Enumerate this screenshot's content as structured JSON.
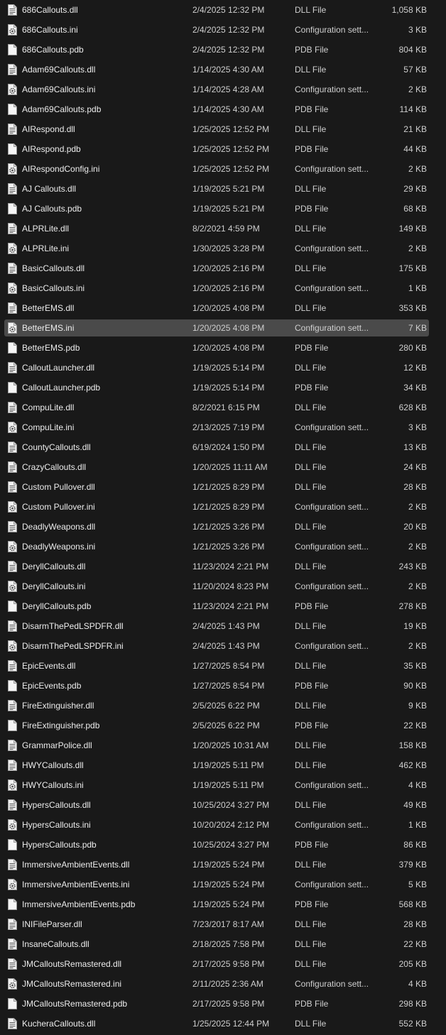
{
  "colors": {
    "background": "#191919",
    "selected_row": "#4a4a4a",
    "text": "#e6e6e6"
  },
  "files": [
    {
      "name": "686Callouts.dll",
      "date": "2/4/2025 12:32 PM",
      "type": "DLL File",
      "size": "1,058 KB",
      "icon": "dll-file-icon"
    },
    {
      "name": "686Callouts.ini",
      "date": "2/4/2025 12:32 PM",
      "type": "Configuration sett...",
      "size": "3 KB",
      "icon": "config-file-icon"
    },
    {
      "name": "686Callouts.pdb",
      "date": "2/4/2025 12:32 PM",
      "type": "PDB File",
      "size": "804 KB",
      "icon": "blank-file-icon"
    },
    {
      "name": "Adam69Callouts.dll",
      "date": "1/14/2025 4:30 AM",
      "type": "DLL File",
      "size": "57 KB",
      "icon": "dll-file-icon"
    },
    {
      "name": "Adam69Callouts.ini",
      "date": "1/14/2025 4:28 AM",
      "type": "Configuration sett...",
      "size": "2 KB",
      "icon": "config-file-icon"
    },
    {
      "name": "Adam69Callouts.pdb",
      "date": "1/14/2025 4:30 AM",
      "type": "PDB File",
      "size": "114 KB",
      "icon": "blank-file-icon"
    },
    {
      "name": "AIRespond.dll",
      "date": "1/25/2025 12:52 PM",
      "type": "DLL File",
      "size": "21 KB",
      "icon": "dll-file-icon"
    },
    {
      "name": "AIRespond.pdb",
      "date": "1/25/2025 12:52 PM",
      "type": "PDB File",
      "size": "44 KB",
      "icon": "blank-file-icon"
    },
    {
      "name": "AIRespondConfig.ini",
      "date": "1/25/2025 12:52 PM",
      "type": "Configuration sett...",
      "size": "2 KB",
      "icon": "config-file-icon"
    },
    {
      "name": "AJ Callouts.dll",
      "date": "1/19/2025 5:21 PM",
      "type": "DLL File",
      "size": "29 KB",
      "icon": "dll-file-icon"
    },
    {
      "name": "AJ Callouts.pdb",
      "date": "1/19/2025 5:21 PM",
      "type": "PDB File",
      "size": "68 KB",
      "icon": "blank-file-icon"
    },
    {
      "name": "ALPRLite.dll",
      "date": "8/2/2021 4:59 PM",
      "type": "DLL File",
      "size": "149 KB",
      "icon": "dll-file-icon"
    },
    {
      "name": "ALPRLite.ini",
      "date": "1/30/2025 3:28 PM",
      "type": "Configuration sett...",
      "size": "2 KB",
      "icon": "config-file-icon"
    },
    {
      "name": "BasicCallouts.dll",
      "date": "1/20/2025 2:16 PM",
      "type": "DLL File",
      "size": "175 KB",
      "icon": "dll-file-icon"
    },
    {
      "name": "BasicCallouts.ini",
      "date": "1/20/2025 2:16 PM",
      "type": "Configuration sett...",
      "size": "1 KB",
      "icon": "config-file-icon"
    },
    {
      "name": "BetterEMS.dll",
      "date": "1/20/2025 4:08 PM",
      "type": "DLL File",
      "size": "353 KB",
      "icon": "dll-file-icon"
    },
    {
      "name": "BetterEMS.ini",
      "date": "1/20/2025 4:08 PM",
      "type": "Configuration sett...",
      "size": "7 KB",
      "icon": "config-file-icon",
      "selected": true
    },
    {
      "name": "BetterEMS.pdb",
      "date": "1/20/2025 4:08 PM",
      "type": "PDB File",
      "size": "280 KB",
      "icon": "blank-file-icon"
    },
    {
      "name": "CalloutLauncher.dll",
      "date": "1/19/2025 5:14 PM",
      "type": "DLL File",
      "size": "12 KB",
      "icon": "dll-file-icon"
    },
    {
      "name": "CalloutLauncher.pdb",
      "date": "1/19/2025 5:14 PM",
      "type": "PDB File",
      "size": "34 KB",
      "icon": "blank-file-icon"
    },
    {
      "name": "CompuLite.dll",
      "date": "8/2/2021 6:15 PM",
      "type": "DLL File",
      "size": "628 KB",
      "icon": "dll-file-icon"
    },
    {
      "name": "CompuLite.ini",
      "date": "2/13/2025 7:19 PM",
      "type": "Configuration sett...",
      "size": "3 KB",
      "icon": "config-file-icon"
    },
    {
      "name": "CountyCallouts.dll",
      "date": "6/19/2024 1:50 PM",
      "type": "DLL File",
      "size": "13 KB",
      "icon": "dll-file-icon"
    },
    {
      "name": "CrazyCallouts.dll",
      "date": "1/20/2025 11:11 AM",
      "type": "DLL File",
      "size": "24 KB",
      "icon": "dll-file-icon"
    },
    {
      "name": "Custom Pullover.dll",
      "date": "1/21/2025 8:29 PM",
      "type": "DLL File",
      "size": "28 KB",
      "icon": "dll-file-icon"
    },
    {
      "name": "Custom Pullover.ini",
      "date": "1/21/2025 8:29 PM",
      "type": "Configuration sett...",
      "size": "2 KB",
      "icon": "config-file-icon"
    },
    {
      "name": "DeadlyWeapons.dll",
      "date": "1/21/2025 3:26 PM",
      "type": "DLL File",
      "size": "20 KB",
      "icon": "dll-file-icon"
    },
    {
      "name": "DeadlyWeapons.ini",
      "date": "1/21/2025 3:26 PM",
      "type": "Configuration sett...",
      "size": "2 KB",
      "icon": "config-file-icon"
    },
    {
      "name": "DeryllCallouts.dll",
      "date": "11/23/2024 2:21 PM",
      "type": "DLL File",
      "size": "243 KB",
      "icon": "dll-file-icon"
    },
    {
      "name": "DeryllCallouts.ini",
      "date": "11/20/2024 8:23 PM",
      "type": "Configuration sett...",
      "size": "2 KB",
      "icon": "config-file-icon"
    },
    {
      "name": "DeryllCallouts.pdb",
      "date": "11/23/2024 2:21 PM",
      "type": "PDB File",
      "size": "278 KB",
      "icon": "blank-file-icon"
    },
    {
      "name": "DisarmThePedLSPDFR.dll",
      "date": "2/4/2025 1:43 PM",
      "type": "DLL File",
      "size": "19 KB",
      "icon": "dll-file-icon"
    },
    {
      "name": "DisarmThePedLSPDFR.ini",
      "date": "2/4/2025 1:43 PM",
      "type": "Configuration sett...",
      "size": "2 KB",
      "icon": "config-file-icon"
    },
    {
      "name": "EpicEvents.dll",
      "date": "1/27/2025 8:54 PM",
      "type": "DLL File",
      "size": "35 KB",
      "icon": "dll-file-icon"
    },
    {
      "name": "EpicEvents.pdb",
      "date": "1/27/2025 8:54 PM",
      "type": "PDB File",
      "size": "90 KB",
      "icon": "blank-file-icon"
    },
    {
      "name": "FireExtinguisher.dll",
      "date": "2/5/2025 6:22 PM",
      "type": "DLL File",
      "size": "9 KB",
      "icon": "dll-file-icon"
    },
    {
      "name": "FireExtinguisher.pdb",
      "date": "2/5/2025 6:22 PM",
      "type": "PDB File",
      "size": "22 KB",
      "icon": "blank-file-icon"
    },
    {
      "name": "GrammarPolice.dll",
      "date": "1/20/2025 10:31 AM",
      "type": "DLL File",
      "size": "158 KB",
      "icon": "dll-file-icon"
    },
    {
      "name": "HWYCallouts.dll",
      "date": "1/19/2025 5:11 PM",
      "type": "DLL File",
      "size": "462 KB",
      "icon": "dll-file-icon"
    },
    {
      "name": "HWYCallouts.ini",
      "date": "1/19/2025 5:11 PM",
      "type": "Configuration sett...",
      "size": "4 KB",
      "icon": "config-file-icon"
    },
    {
      "name": "HypersCallouts.dll",
      "date": "10/25/2024 3:27 PM",
      "type": "DLL File",
      "size": "49 KB",
      "icon": "dll-file-icon"
    },
    {
      "name": "HypersCallouts.ini",
      "date": "10/20/2024 2:12 PM",
      "type": "Configuration sett...",
      "size": "1 KB",
      "icon": "config-file-icon"
    },
    {
      "name": "HypersCallouts.pdb",
      "date": "10/25/2024 3:27 PM",
      "type": "PDB File",
      "size": "86 KB",
      "icon": "blank-file-icon"
    },
    {
      "name": "ImmersiveAmbientEvents.dll",
      "date": "1/19/2025 5:24 PM",
      "type": "DLL File",
      "size": "379 KB",
      "icon": "dll-file-icon"
    },
    {
      "name": "ImmersiveAmbientEvents.ini",
      "date": "1/19/2025 5:24 PM",
      "type": "Configuration sett...",
      "size": "5 KB",
      "icon": "config-file-icon"
    },
    {
      "name": "ImmersiveAmbientEvents.pdb",
      "date": "1/19/2025 5:24 PM",
      "type": "PDB File",
      "size": "568 KB",
      "icon": "blank-file-icon"
    },
    {
      "name": "INIFileParser.dll",
      "date": "7/23/2017 8:17 AM",
      "type": "DLL File",
      "size": "28 KB",
      "icon": "dll-file-icon"
    },
    {
      "name": "InsaneCallouts.dll",
      "date": "2/18/2025 7:58 PM",
      "type": "DLL File",
      "size": "22 KB",
      "icon": "dll-file-icon"
    },
    {
      "name": "JMCalloutsRemastered.dll",
      "date": "2/17/2025 9:58 PM",
      "type": "DLL File",
      "size": "205 KB",
      "icon": "dll-file-icon"
    },
    {
      "name": "JMCalloutsRemastered.ini",
      "date": "2/11/2025 2:36 AM",
      "type": "Configuration sett...",
      "size": "4 KB",
      "icon": "config-file-icon"
    },
    {
      "name": "JMCalloutsRemastered.pdb",
      "date": "2/17/2025 9:58 PM",
      "type": "PDB File",
      "size": "298 KB",
      "icon": "blank-file-icon"
    },
    {
      "name": "KucheraCallouts.dll",
      "date": "1/25/2025 12:44 PM",
      "type": "DLL File",
      "size": "552 KB",
      "icon": "dll-file-icon"
    }
  ]
}
